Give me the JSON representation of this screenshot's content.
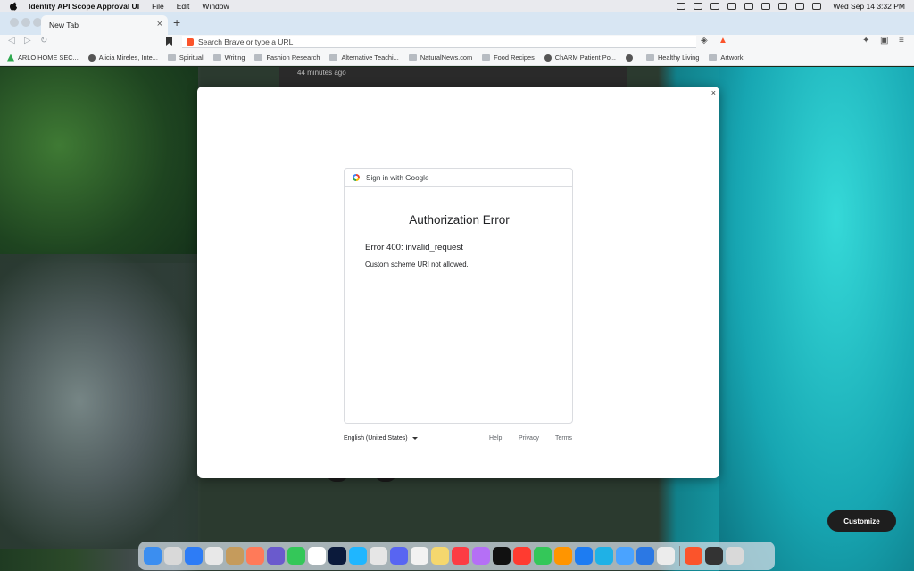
{
  "menubar": {
    "app_name": "Identity API Scope Approval UI",
    "menus": [
      "File",
      "Edit",
      "Window"
    ],
    "clock": "Wed Sep 14  3:32 PM"
  },
  "browser": {
    "tab_title": "New Tab",
    "new_tab_symbol": "+",
    "omnibox_placeholder": "Search Brave or type a URL",
    "bookmarks": [
      {
        "label": "ARLO HOME SEC...",
        "icon": "leaf"
      },
      {
        "label": "Alicia Mireles, Inte...",
        "icon": "globe"
      },
      {
        "label": "Spiritual",
        "icon": "folder"
      },
      {
        "label": "Writing",
        "icon": "folder"
      },
      {
        "label": "Fashion Research",
        "icon": "folder"
      },
      {
        "label": "Alternative Teachi...",
        "icon": "folder"
      },
      {
        "label": "NaturalNews.com",
        "icon": "folder"
      },
      {
        "label": "Food Recipes",
        "icon": "folder"
      },
      {
        "label": "ChARM Patient Po...",
        "icon": "globe"
      },
      {
        "label": "",
        "icon": "globe"
      },
      {
        "label": "Healthy Living",
        "icon": "folder"
      },
      {
        "label": "Artwork",
        "icon": "folder"
      }
    ]
  },
  "newtab": {
    "feed_time": "44 minutes ago",
    "customize_label": "Customize"
  },
  "dialog": {
    "close_symbol": "×",
    "header": "Sign in with Google",
    "title": "Authorization Error",
    "error_code": "Error 400: invalid_request",
    "error_message": "Custom scheme URI not allowed.",
    "language": "English (United States)",
    "footer_links": [
      "Help",
      "Privacy",
      "Terms"
    ]
  },
  "dock": {
    "app_colors": [
      "#3b8ef0",
      "#d9d9d9",
      "#2d7cf6",
      "#e8e8e8",
      "#c59b5c",
      "#ff7a59",
      "#6a5acd",
      "#34c759",
      "#ffffff",
      "#0b1a3b",
      "#1fb6ff",
      "#e6e6e6",
      "#5865f2",
      "#f2f2f2",
      "#f5d76e",
      "#fc3c44",
      "#b56ff6",
      "#111111",
      "#ff3b30",
      "#34c759",
      "#ff9500",
      "#1d7cf2",
      "#1fb1e6",
      "#4aa3ff",
      "#2b78e4",
      "#ececec",
      "#fb542b",
      "#333333",
      "#d9d9d9"
    ]
  }
}
